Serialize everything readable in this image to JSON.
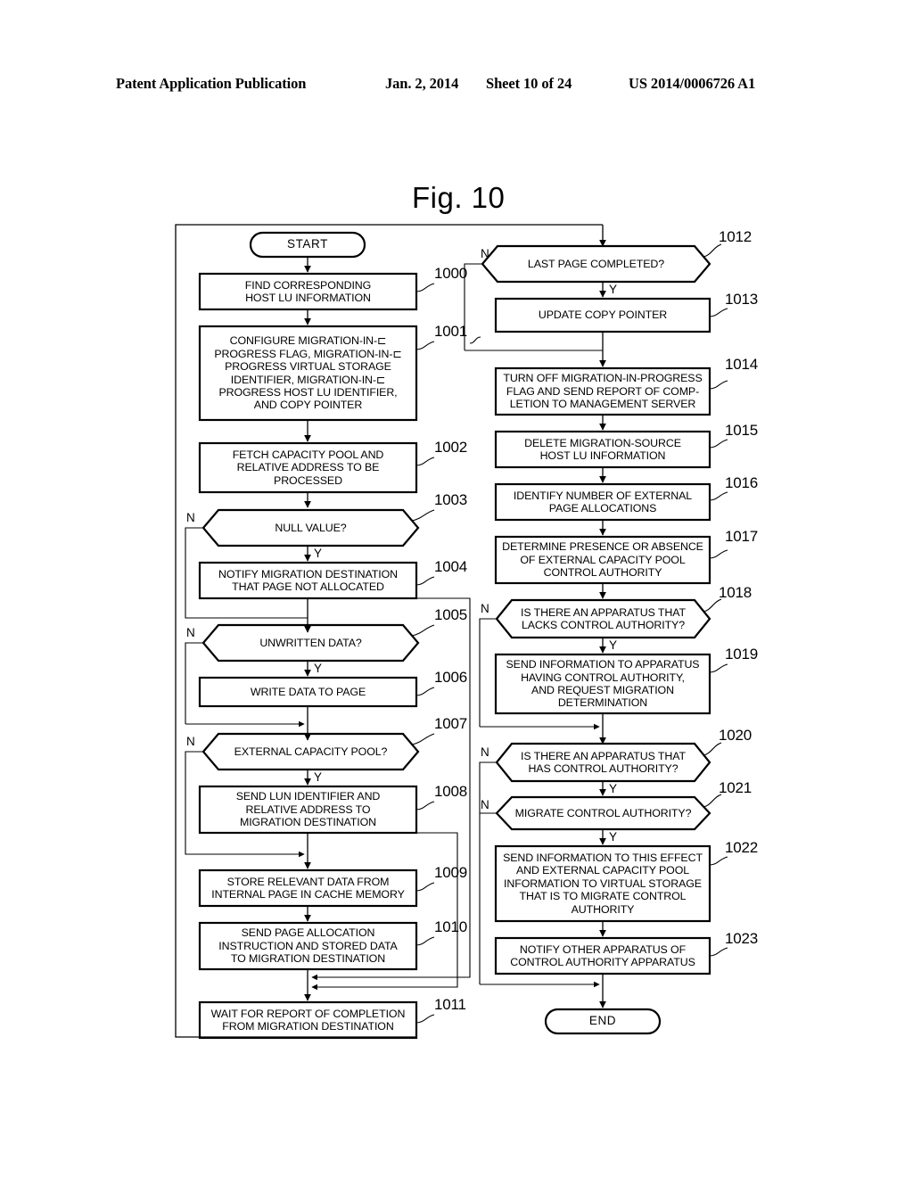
{
  "header": {
    "publication": "Patent Application Publication",
    "date": "Jan. 2, 2014",
    "sheet": "Sheet 10 of 24",
    "number": "US 2014/0006726 A1"
  },
  "figure": {
    "title": "Fig. 10"
  },
  "flowchart": {
    "start_label": "START",
    "end_label": "END",
    "yes_letter": "Y",
    "no_letter": "N",
    "nodes": [
      {
        "id": "start",
        "ref": "",
        "shape": "terminal",
        "text": "START"
      },
      {
        "id": "n1000",
        "ref": "1000",
        "shape": "process",
        "text": "FIND CORRESPONDING\nHOST LU INFORMATION"
      },
      {
        "id": "n1001",
        "ref": "1001",
        "shape": "process",
        "text": "CONFIGURE MIGRATION-IN-⊏\nPROGRESS FLAG, MIGRATION-IN-⊏\nPROGRESS VIRTUAL STORAGE\nIDENTIFIER, MIGRATION-IN-⊏\nPROGRESS HOST LU IDENTIFIER,\nAND COPY POINTER"
      },
      {
        "id": "n1002",
        "ref": "1002",
        "shape": "process",
        "text": "FETCH CAPACITY POOL AND\nRELATIVE ADDRESS TO BE\nPROCESSED"
      },
      {
        "id": "n1003",
        "ref": "1003",
        "shape": "decision",
        "text": "NULL VALUE?"
      },
      {
        "id": "n1004",
        "ref": "1004",
        "shape": "process",
        "text": "NOTIFY MIGRATION DESTINATION\nTHAT PAGE NOT ALLOCATED"
      },
      {
        "id": "n1005",
        "ref": "1005",
        "shape": "decision",
        "text": "UNWRITTEN DATA?"
      },
      {
        "id": "n1006",
        "ref": "1006",
        "shape": "process",
        "text": "WRITE DATA TO PAGE"
      },
      {
        "id": "n1007",
        "ref": "1007",
        "shape": "decision",
        "text": "EXTERNAL CAPACITY POOL?"
      },
      {
        "id": "n1008",
        "ref": "1008",
        "shape": "process",
        "text": "SEND LUN IDENTIFIER AND\nRELATIVE ADDRESS TO\nMIGRATION DESTINATION"
      },
      {
        "id": "n1009",
        "ref": "1009",
        "shape": "process",
        "text": "STORE RELEVANT DATA FROM\nINTERNAL PAGE IN CACHE MEMORY"
      },
      {
        "id": "n1010",
        "ref": "1010",
        "shape": "process",
        "text": "SEND PAGE ALLOCATION\nINSTRUCTION AND STORED DATA\nTO MIGRATION DESTINATION"
      },
      {
        "id": "n1011",
        "ref": "1011",
        "shape": "process",
        "text": "WAIT FOR REPORT OF COMPLETION\nFROM MIGRATION DESTINATION"
      },
      {
        "id": "n1012",
        "ref": "1012",
        "shape": "decision",
        "text": "LAST PAGE COMPLETED?"
      },
      {
        "id": "n1013",
        "ref": "1013",
        "shape": "process",
        "text": "UPDATE COPY POINTER"
      },
      {
        "id": "n1014",
        "ref": "1014",
        "shape": "process",
        "text": "TURN OFF MIGRATION-IN-PROGRESS\nFLAG AND SEND REPORT OF COMP-\nLETION TO MANAGEMENT SERVER"
      },
      {
        "id": "n1015",
        "ref": "1015",
        "shape": "process",
        "text": "DELETE MIGRATION-SOURCE\nHOST LU INFORMATION"
      },
      {
        "id": "n1016",
        "ref": "1016",
        "shape": "process",
        "text": "IDENTIFY NUMBER OF EXTERNAL\nPAGE ALLOCATIONS"
      },
      {
        "id": "n1017",
        "ref": "1017",
        "shape": "process",
        "text": "DETERMINE PRESENCE OR ABSENCE\nOF EXTERNAL CAPACITY POOL\nCONTROL AUTHORITY"
      },
      {
        "id": "n1018",
        "ref": "1018",
        "shape": "decision",
        "text": "IS THERE AN APPARATUS THAT\nLACKS CONTROL AUTHORITY?"
      },
      {
        "id": "n1019",
        "ref": "1019",
        "shape": "process",
        "text": "SEND INFORMATION TO APPARATUS\nHAVING CONTROL AUTHORITY,\nAND REQUEST MIGRATION\nDETERMINATION"
      },
      {
        "id": "n1020",
        "ref": "1020",
        "shape": "decision",
        "text": "IS THERE AN APPARATUS THAT\nHAS CONTROL AUTHORITY?"
      },
      {
        "id": "n1021",
        "ref": "1021",
        "shape": "decision",
        "text": "MIGRATE CONTROL AUTHORITY?"
      },
      {
        "id": "n1022",
        "ref": "1022",
        "shape": "process",
        "text": "SEND INFORMATION TO THIS EFFECT\nAND EXTERNAL CAPACITY POOL\nINFORMATION TO VIRTUAL STORAGE\nTHAT IS TO MIGRATE CONTROL\nAUTHORITY"
      },
      {
        "id": "n1023",
        "ref": "1023",
        "shape": "process",
        "text": "NOTIFY OTHER APPARATUS OF\nCONTROL AUTHORITY APPARATUS"
      },
      {
        "id": "end",
        "ref": "",
        "shape": "terminal",
        "text": "END"
      }
    ]
  }
}
